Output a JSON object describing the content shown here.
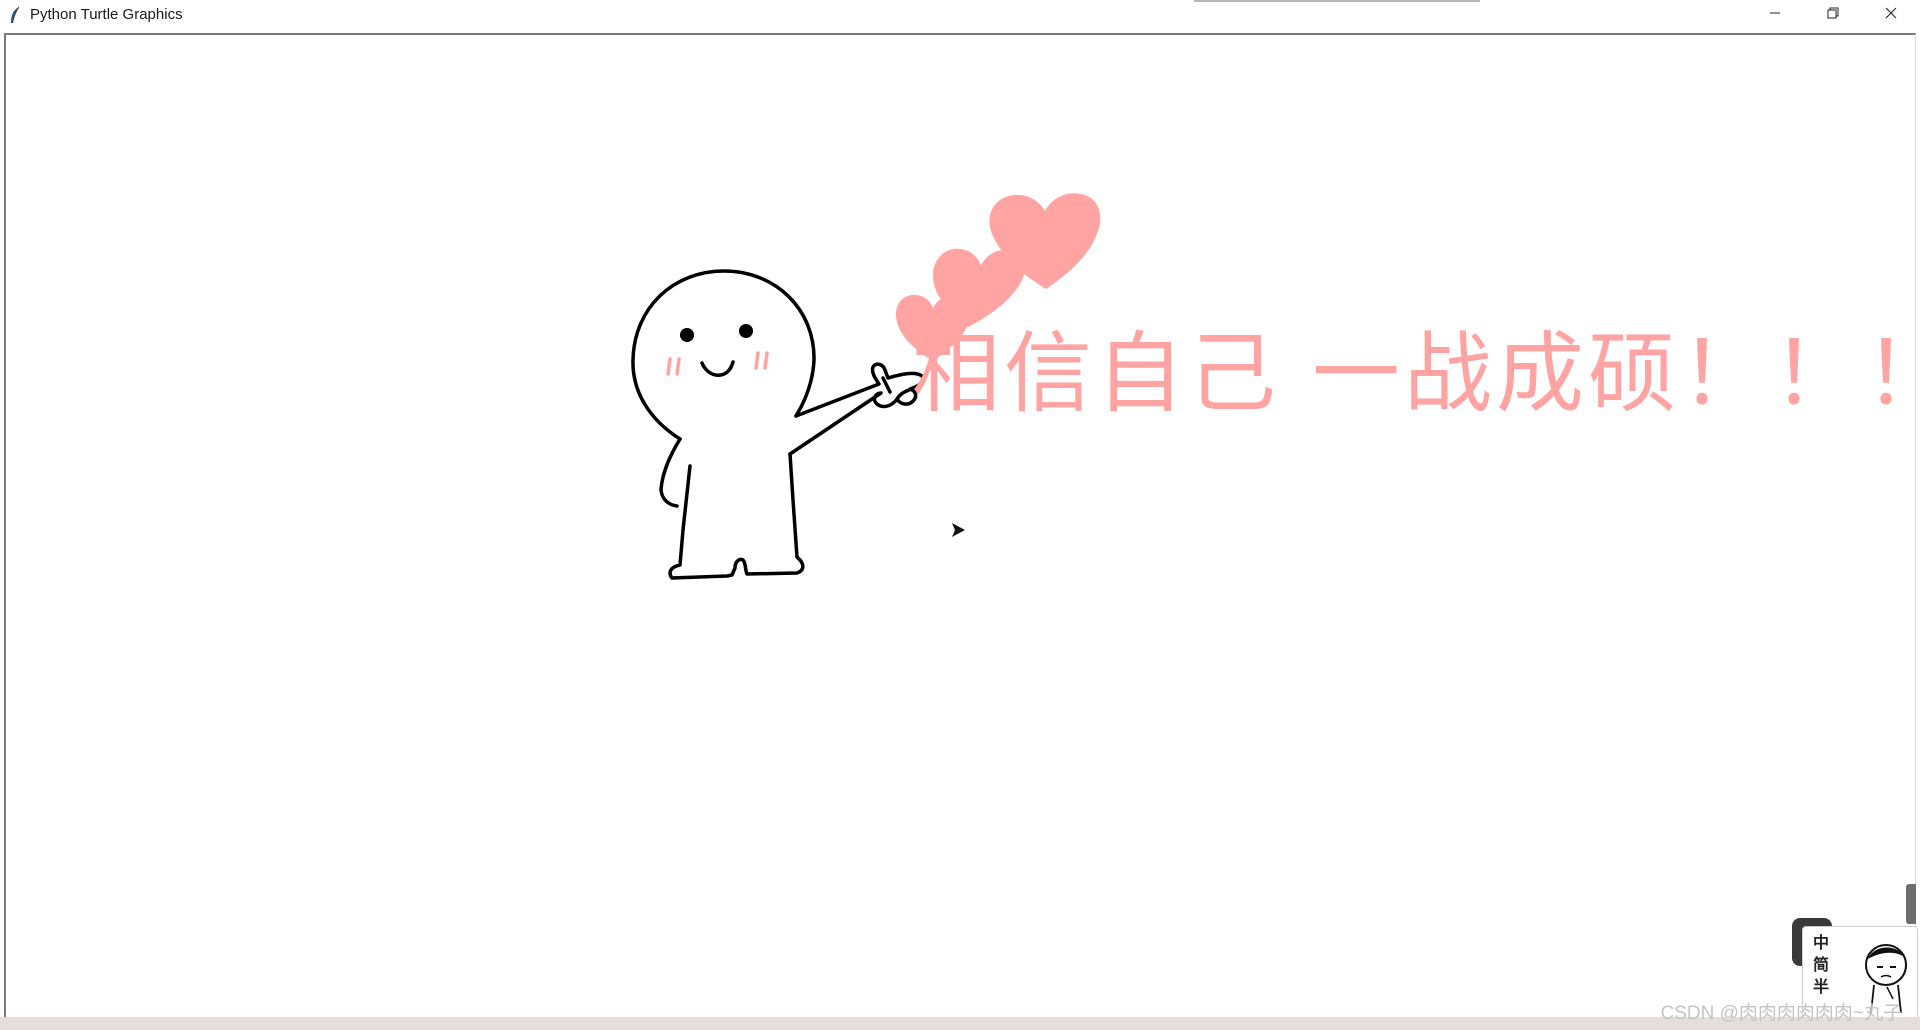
{
  "window": {
    "title": "Python Turtle Graphics",
    "controls": {
      "minimize": "minimize-icon",
      "restore": "restore-icon",
      "close": "close-icon"
    }
  },
  "canvas": {
    "slogan": "相信自己 一战成硕！！！",
    "slogan_color": "#ffa3a3",
    "heart_color": "#ffa3a3",
    "ink_color": "#000000",
    "blush_color": "#ffa3a3"
  },
  "ime": {
    "chars": [
      "中",
      "简",
      "半"
    ]
  },
  "watermark": "CSDN @肉肉肉肉肉肉~丸子"
}
